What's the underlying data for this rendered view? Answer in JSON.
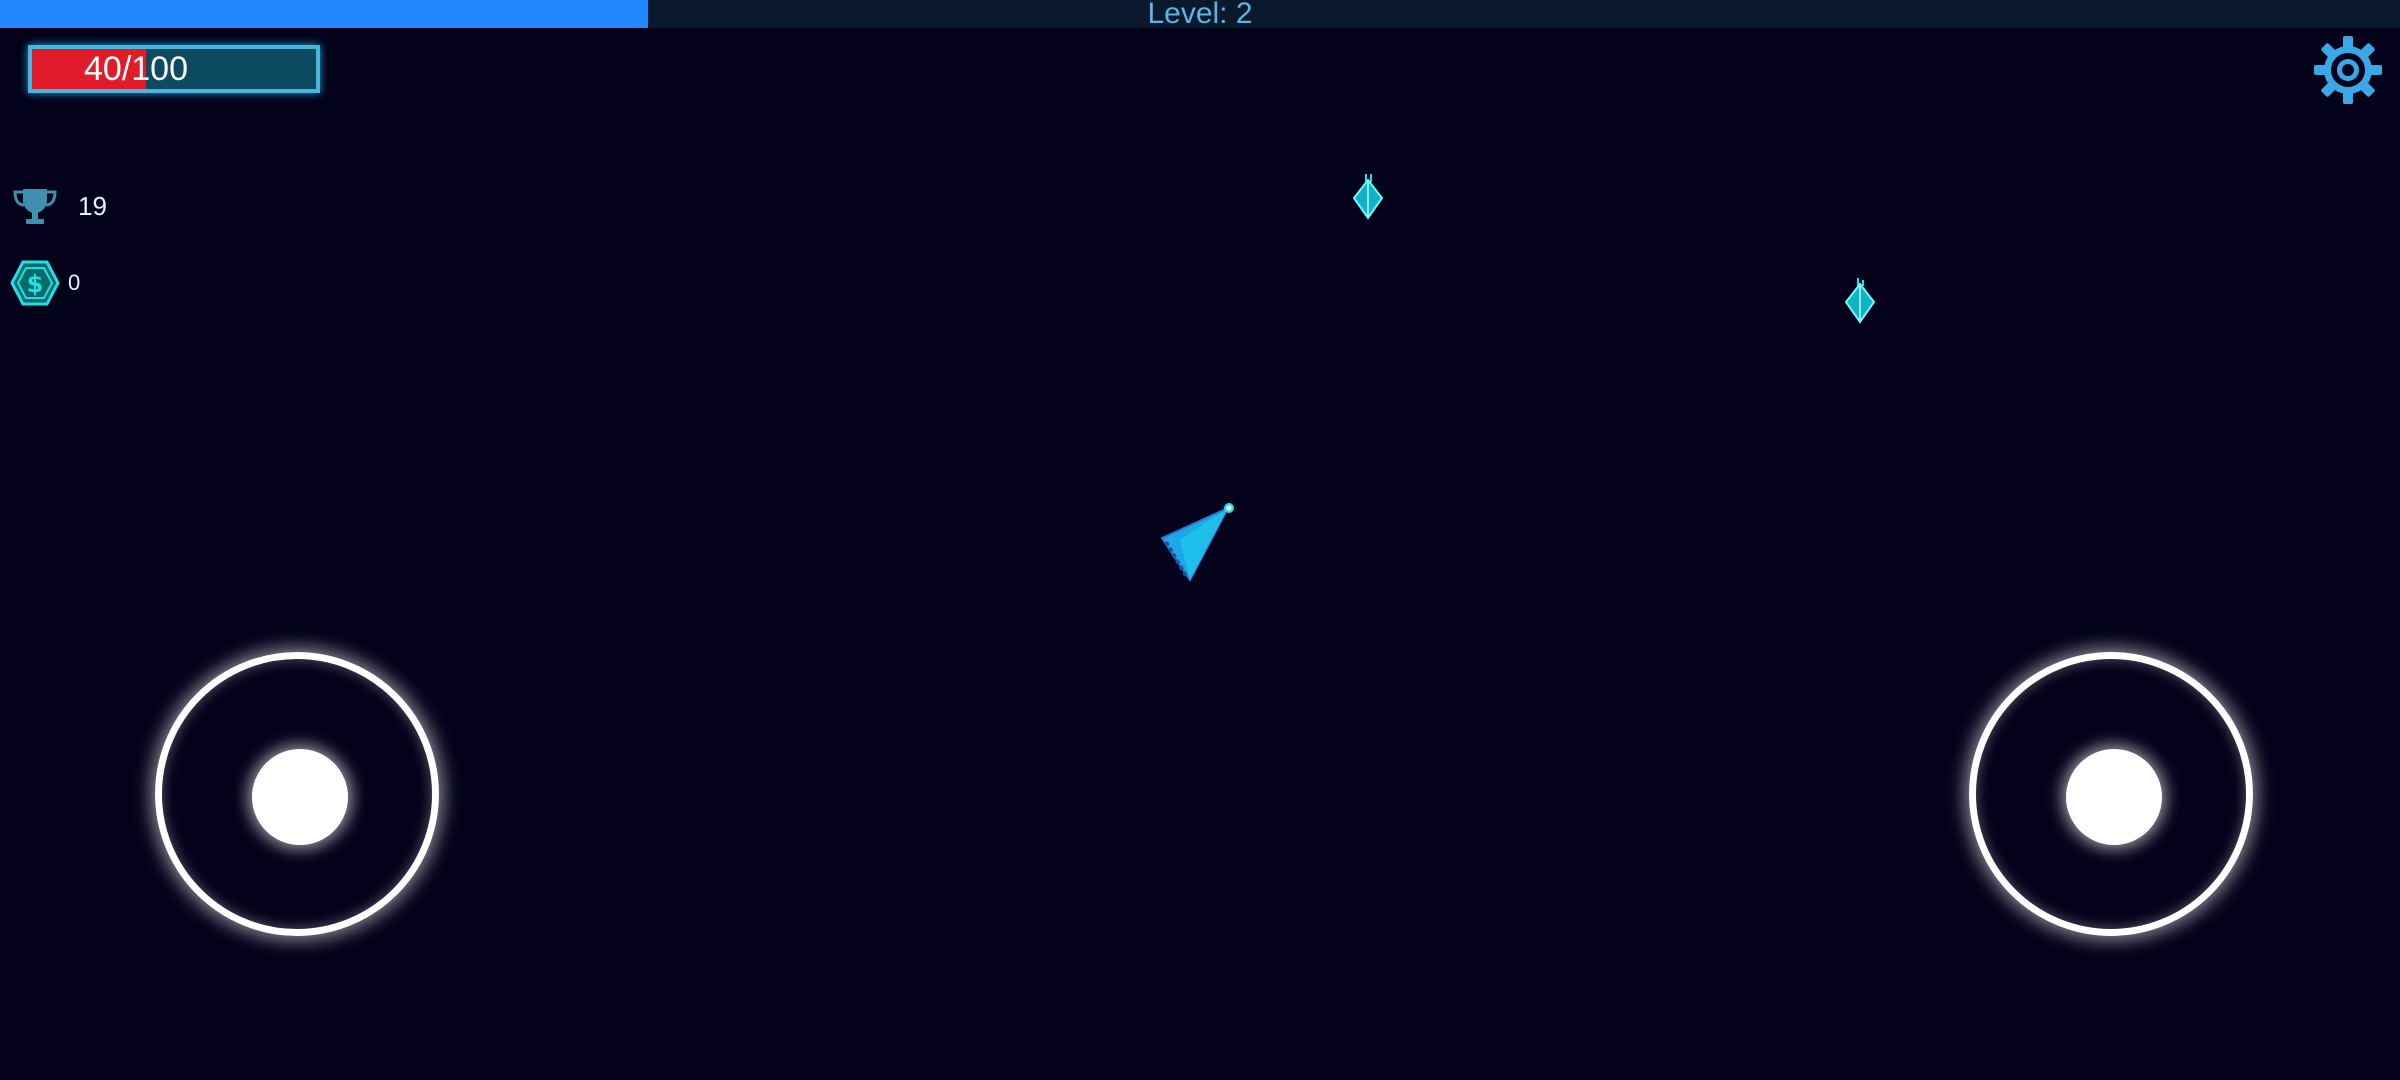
{
  "level": {
    "label": "Level: 2",
    "progress_fraction": 0.27
  },
  "health": {
    "text": "40/100",
    "current": 40,
    "max": 100
  },
  "stats": {
    "trophy_count": "19",
    "coin_count": "0"
  },
  "icons": {
    "settings": "gear-icon",
    "trophy": "trophy-icon",
    "coin": "dollar-coin-icon",
    "player": "player-ship",
    "enemy": "enemy-crystal"
  },
  "colors": {
    "background": "#03021a",
    "level_fill": "#2188ff",
    "level_text": "#5ab4e6",
    "health_fill": "#e01c2b",
    "health_frame": "#48b6dd",
    "accent_cyan": "#1ee0e6",
    "joystick": "#ffffff"
  }
}
